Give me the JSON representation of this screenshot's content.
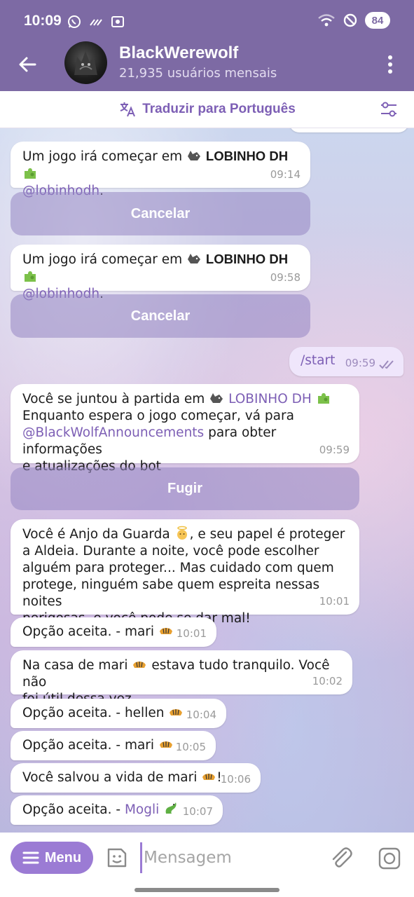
{
  "status_bar": {
    "time": "10:09",
    "battery": "84"
  },
  "header": {
    "title": "BlackWerewolf",
    "subtitle": "21,935 usuários mensais"
  },
  "translate_bar": {
    "label": "Traduzir para Português"
  },
  "messages": [
    {
      "type": "in",
      "parts": [
        "Um jogo irá começar em",
        "LOBINHO DH",
        "@lobinhodh",
        "."
      ],
      "time": "09:14"
    },
    {
      "type": "in",
      "parts": [
        "Um jogo irá começar em",
        "LOBINHO DH",
        "@lobinhodh",
        "."
      ],
      "time": "09:58"
    },
    {
      "type": "out",
      "text": "/start",
      "time": "09:59"
    },
    {
      "type": "in",
      "parts": [
        "Você se juntou à partida em",
        "LOBINHO DH",
        "Enquanto espera o jogo começar, vá para",
        "@BlackWolfAnnouncements",
        "para obter informações",
        "e atualizações do bot"
      ],
      "time": "09:59"
    },
    {
      "type": "in",
      "parts": [
        "Você é Anjo da Guarda",
        ", e seu papel é proteger",
        "a Aldeia. Durante a noite, você pode escolher",
        "alguém para proteger... Mas cuidado com quem",
        "protege, ninguém sabe quem espreita nessas noites",
        "perigosas, e você pode se dar mal!"
      ],
      "time": "10:01"
    },
    {
      "type": "in",
      "text": "Opção aceita. - mari",
      "time": "10:01"
    },
    {
      "type": "in",
      "parts": [
        "Na casa de mari",
        "estava tudo tranquilo. Você não",
        "foi útil dessa vez."
      ],
      "time": "10:02"
    },
    {
      "type": "in",
      "text": "Opção aceita. - hellen",
      "time": "10:04"
    },
    {
      "type": "in",
      "text": "Opção aceita. - mari",
      "time": "10:05"
    },
    {
      "type": "in",
      "parts": [
        "Você salvou a vida de mari",
        "!"
      ],
      "time": "10:06"
    },
    {
      "type": "in",
      "parts": [
        "Opção aceita. -",
        "Mogli"
      ],
      "time": "10:07"
    }
  ],
  "keyboard_buttons": {
    "cancel_1": "Cancelar",
    "cancel_2": "Cancelar",
    "flee": "Fugir"
  },
  "input_bar": {
    "menu_label": "Menu",
    "placeholder": "Mensagem"
  },
  "colors": {
    "header": "#7d6aa4",
    "accent": "#7d5fb5",
    "menu_button": "#9b7bd4"
  }
}
